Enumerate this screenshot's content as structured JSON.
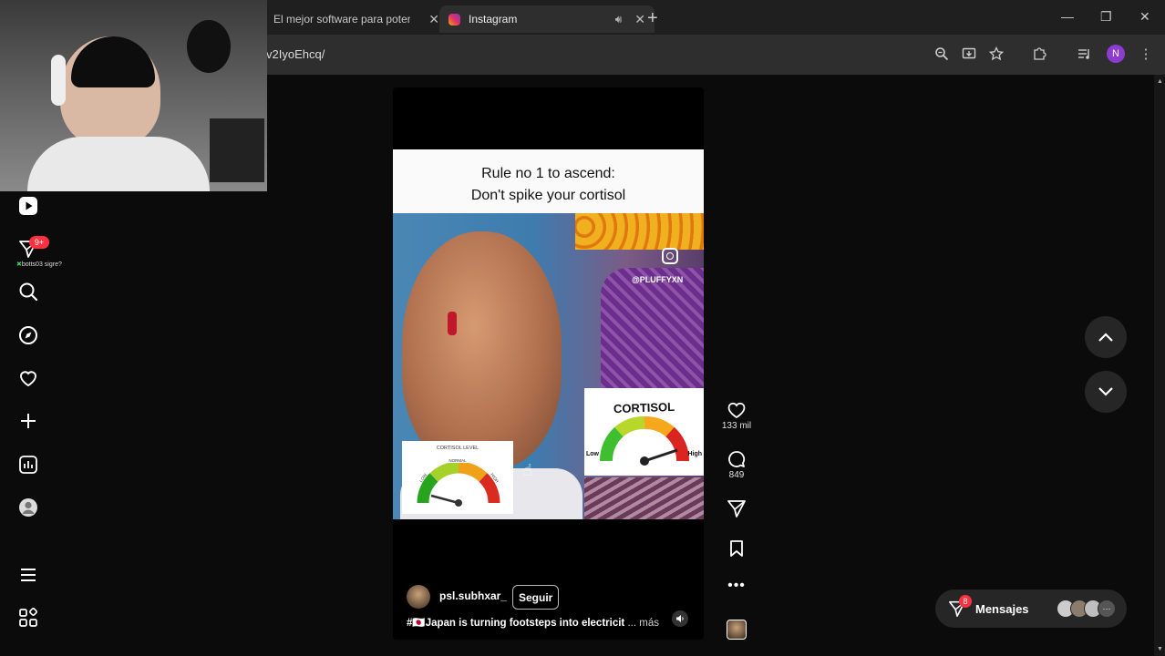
{
  "browser": {
    "tabs": [
      {
        "title": "El mejor software para potencia"
      },
      {
        "title": "Instagram"
      }
    ],
    "url": "v2IyoEhcq/",
    "profile_initial": "N"
  },
  "sidebar": {
    "notification_badge": "9+",
    "activity_user": "botts03",
    "activity_note": "sigre?"
  },
  "reel": {
    "caption_line1": "Rule no 1 to ascend:",
    "caption_line2": "Don't spike your cortisol",
    "watermark": "@PLUFFYXN",
    "gauge_small_title": "CORTISOL LEVEL",
    "gauge_small_mid": "NORMAL",
    "gauge_small_low": "LOW",
    "gauge_small_high": "HIGH",
    "gauge_big_title": "CORTISOL",
    "gauge_big_low": "Low",
    "gauge_big_high": "High",
    "username": "psl.subhxar_",
    "follow_label": "Seguir",
    "description": "#🇯🇵Japan is turning footsteps into electricit",
    "more_label": "... más"
  },
  "actions": {
    "likes": "133 mil",
    "comments": "849"
  },
  "messages": {
    "label": "Mensajes",
    "badge": "8"
  }
}
